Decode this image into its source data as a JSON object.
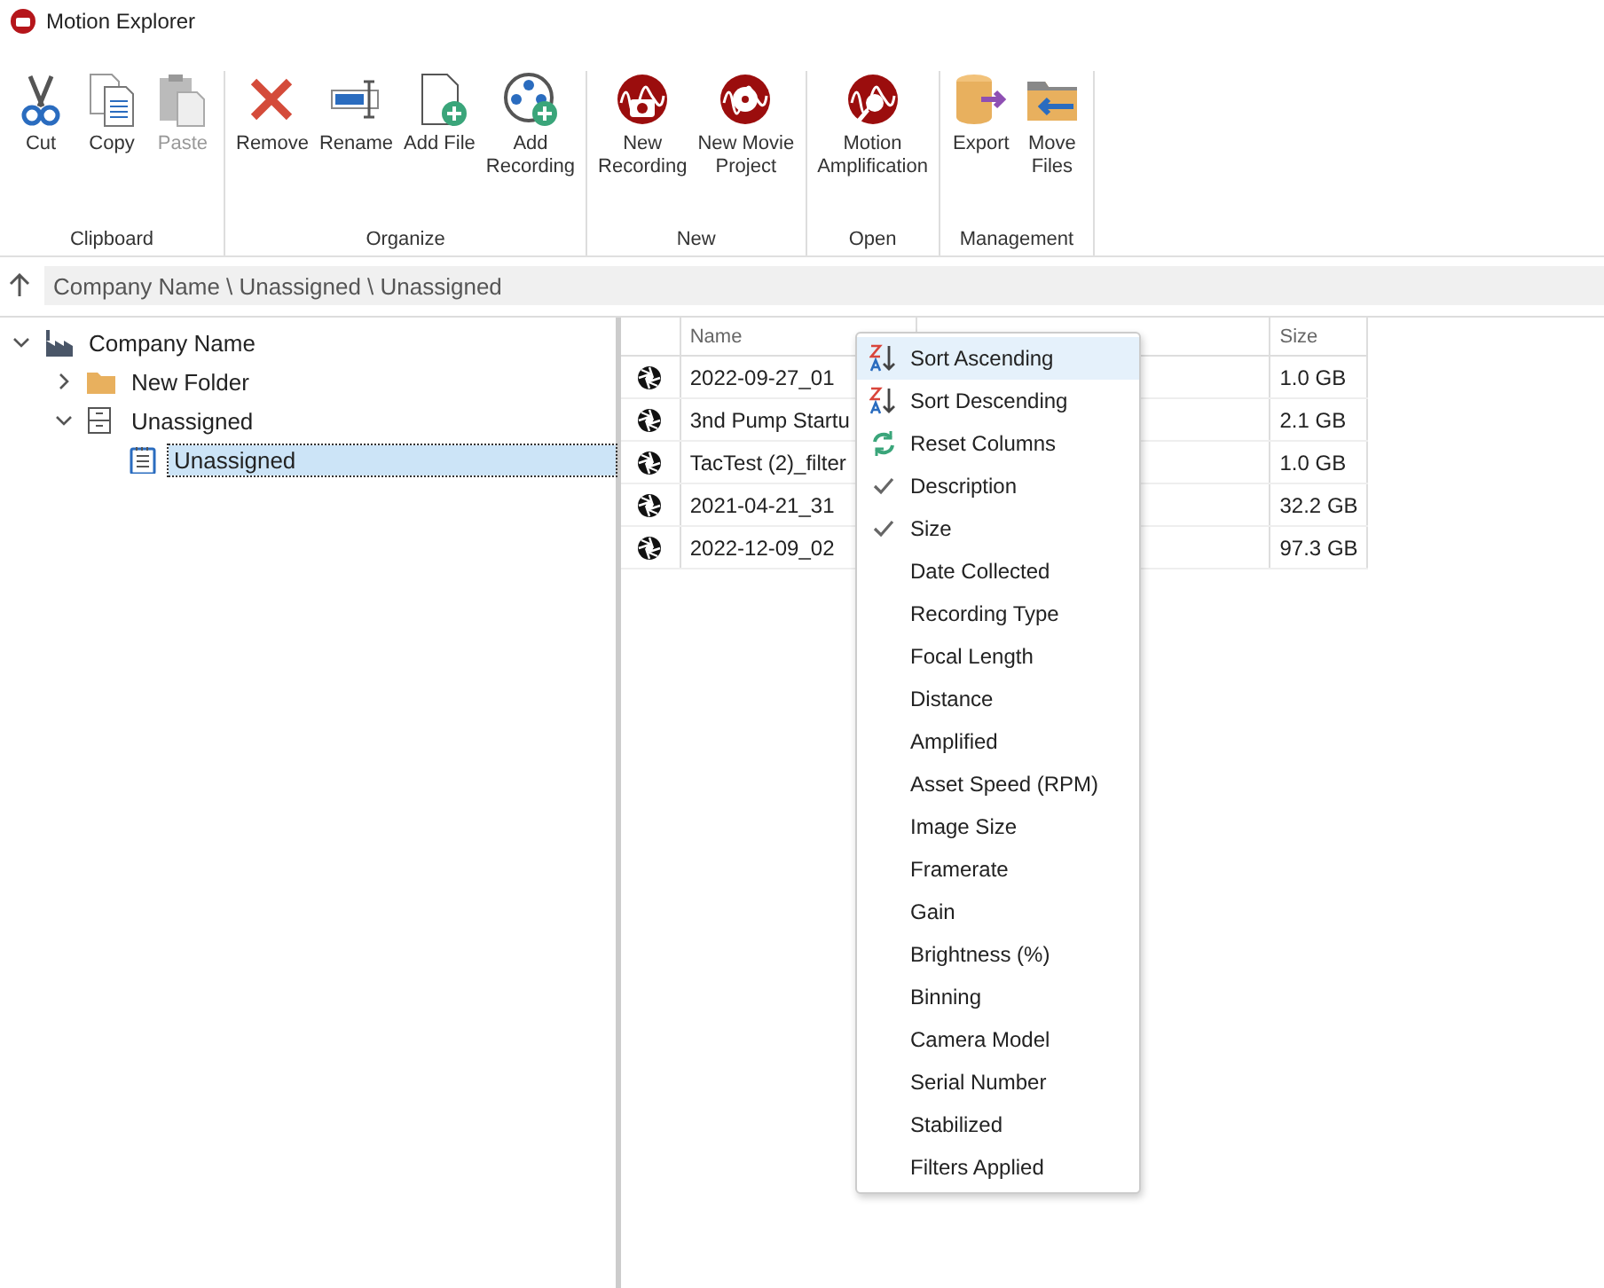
{
  "window": {
    "title": "Motion Explorer"
  },
  "ribbon": {
    "groups": [
      {
        "label": "Clipboard",
        "buttons": [
          {
            "label": "Cut",
            "disabled": false
          },
          {
            "label": "Copy",
            "disabled": false
          },
          {
            "label": "Paste",
            "disabled": true
          }
        ]
      },
      {
        "label": "Organize",
        "buttons": [
          {
            "label": "Remove",
            "disabled": false
          },
          {
            "label": "Rename",
            "disabled": false
          },
          {
            "label": "Add File",
            "disabled": false
          },
          {
            "label": "Add\nRecording",
            "disabled": false
          }
        ]
      },
      {
        "label": "New",
        "buttons": [
          {
            "label": "New\nRecording",
            "disabled": false
          },
          {
            "label": "New Movie\nProject",
            "disabled": false
          }
        ]
      },
      {
        "label": "Open",
        "buttons": [
          {
            "label": "Motion\nAmplification",
            "disabled": false
          }
        ]
      },
      {
        "label": "Management",
        "buttons": [
          {
            "label": "Export",
            "disabled": false
          },
          {
            "label": "Move\nFiles",
            "disabled": false
          }
        ]
      }
    ]
  },
  "address_bar": {
    "path": "Company Name \\ Unassigned \\ Unassigned"
  },
  "tree": [
    {
      "label": "Company Name",
      "kind": "company",
      "expanded": true,
      "selected": false,
      "children": [
        {
          "label": "New Folder",
          "kind": "folder",
          "expanded": false,
          "selected": false
        },
        {
          "label": "Unassigned",
          "kind": "cabinet",
          "expanded": true,
          "selected": false,
          "children": [
            {
              "label": "Unassigned",
              "kind": "notepad",
              "selected": true
            }
          ]
        }
      ]
    }
  ],
  "table": {
    "columns": [
      "Name",
      "Size"
    ],
    "rows": [
      {
        "name": "2022-09-27_01",
        "size": "1.0 GB"
      },
      {
        "name": "3nd Pump Startu",
        "size": "2.1 GB"
      },
      {
        "name": "TacTest (2)_filter",
        "size": "1.0 GB"
      },
      {
        "name": "2021-04-21_31",
        "size": "32.2 GB"
      },
      {
        "name": "2022-12-09_02",
        "size": "97.3 GB"
      }
    ]
  },
  "context_menu": {
    "items": [
      {
        "kind": "sort-asc",
        "label": "Sort Ascending",
        "selected": true
      },
      {
        "kind": "sort-desc",
        "label": "Sort Descending",
        "selected": false
      },
      {
        "kind": "reset",
        "label": "Reset Columns",
        "selected": false
      },
      {
        "kind": "column",
        "label": "Description",
        "checked": true,
        "selected": false
      },
      {
        "kind": "column",
        "label": "Size",
        "checked": true,
        "selected": false
      },
      {
        "kind": "column",
        "label": "Date Collected",
        "checked": false,
        "selected": false
      },
      {
        "kind": "column",
        "label": "Recording Type",
        "checked": false,
        "selected": false
      },
      {
        "kind": "column",
        "label": "Focal Length",
        "checked": false,
        "selected": false
      },
      {
        "kind": "column",
        "label": "Distance",
        "checked": false,
        "selected": false
      },
      {
        "kind": "column",
        "label": "Amplified",
        "checked": false,
        "selected": false
      },
      {
        "kind": "column",
        "label": "Asset Speed (RPM)",
        "checked": false,
        "selected": false
      },
      {
        "kind": "column",
        "label": "Image Size",
        "checked": false,
        "selected": false
      },
      {
        "kind": "column",
        "label": "Framerate",
        "checked": false,
        "selected": false
      },
      {
        "kind": "column",
        "label": "Gain",
        "checked": false,
        "selected": false
      },
      {
        "kind": "column",
        "label": "Brightness (%)",
        "checked": false,
        "selected": false
      },
      {
        "kind": "column",
        "label": "Binning",
        "checked": false,
        "selected": false
      },
      {
        "kind": "column",
        "label": "Camera Model",
        "checked": false,
        "selected": false
      },
      {
        "kind": "column",
        "label": "Serial Number",
        "checked": false,
        "selected": false
      },
      {
        "kind": "column",
        "label": "Stabilized",
        "checked": false,
        "selected": false
      },
      {
        "kind": "column",
        "label": "Filters Applied",
        "checked": false,
        "selected": false
      }
    ]
  }
}
